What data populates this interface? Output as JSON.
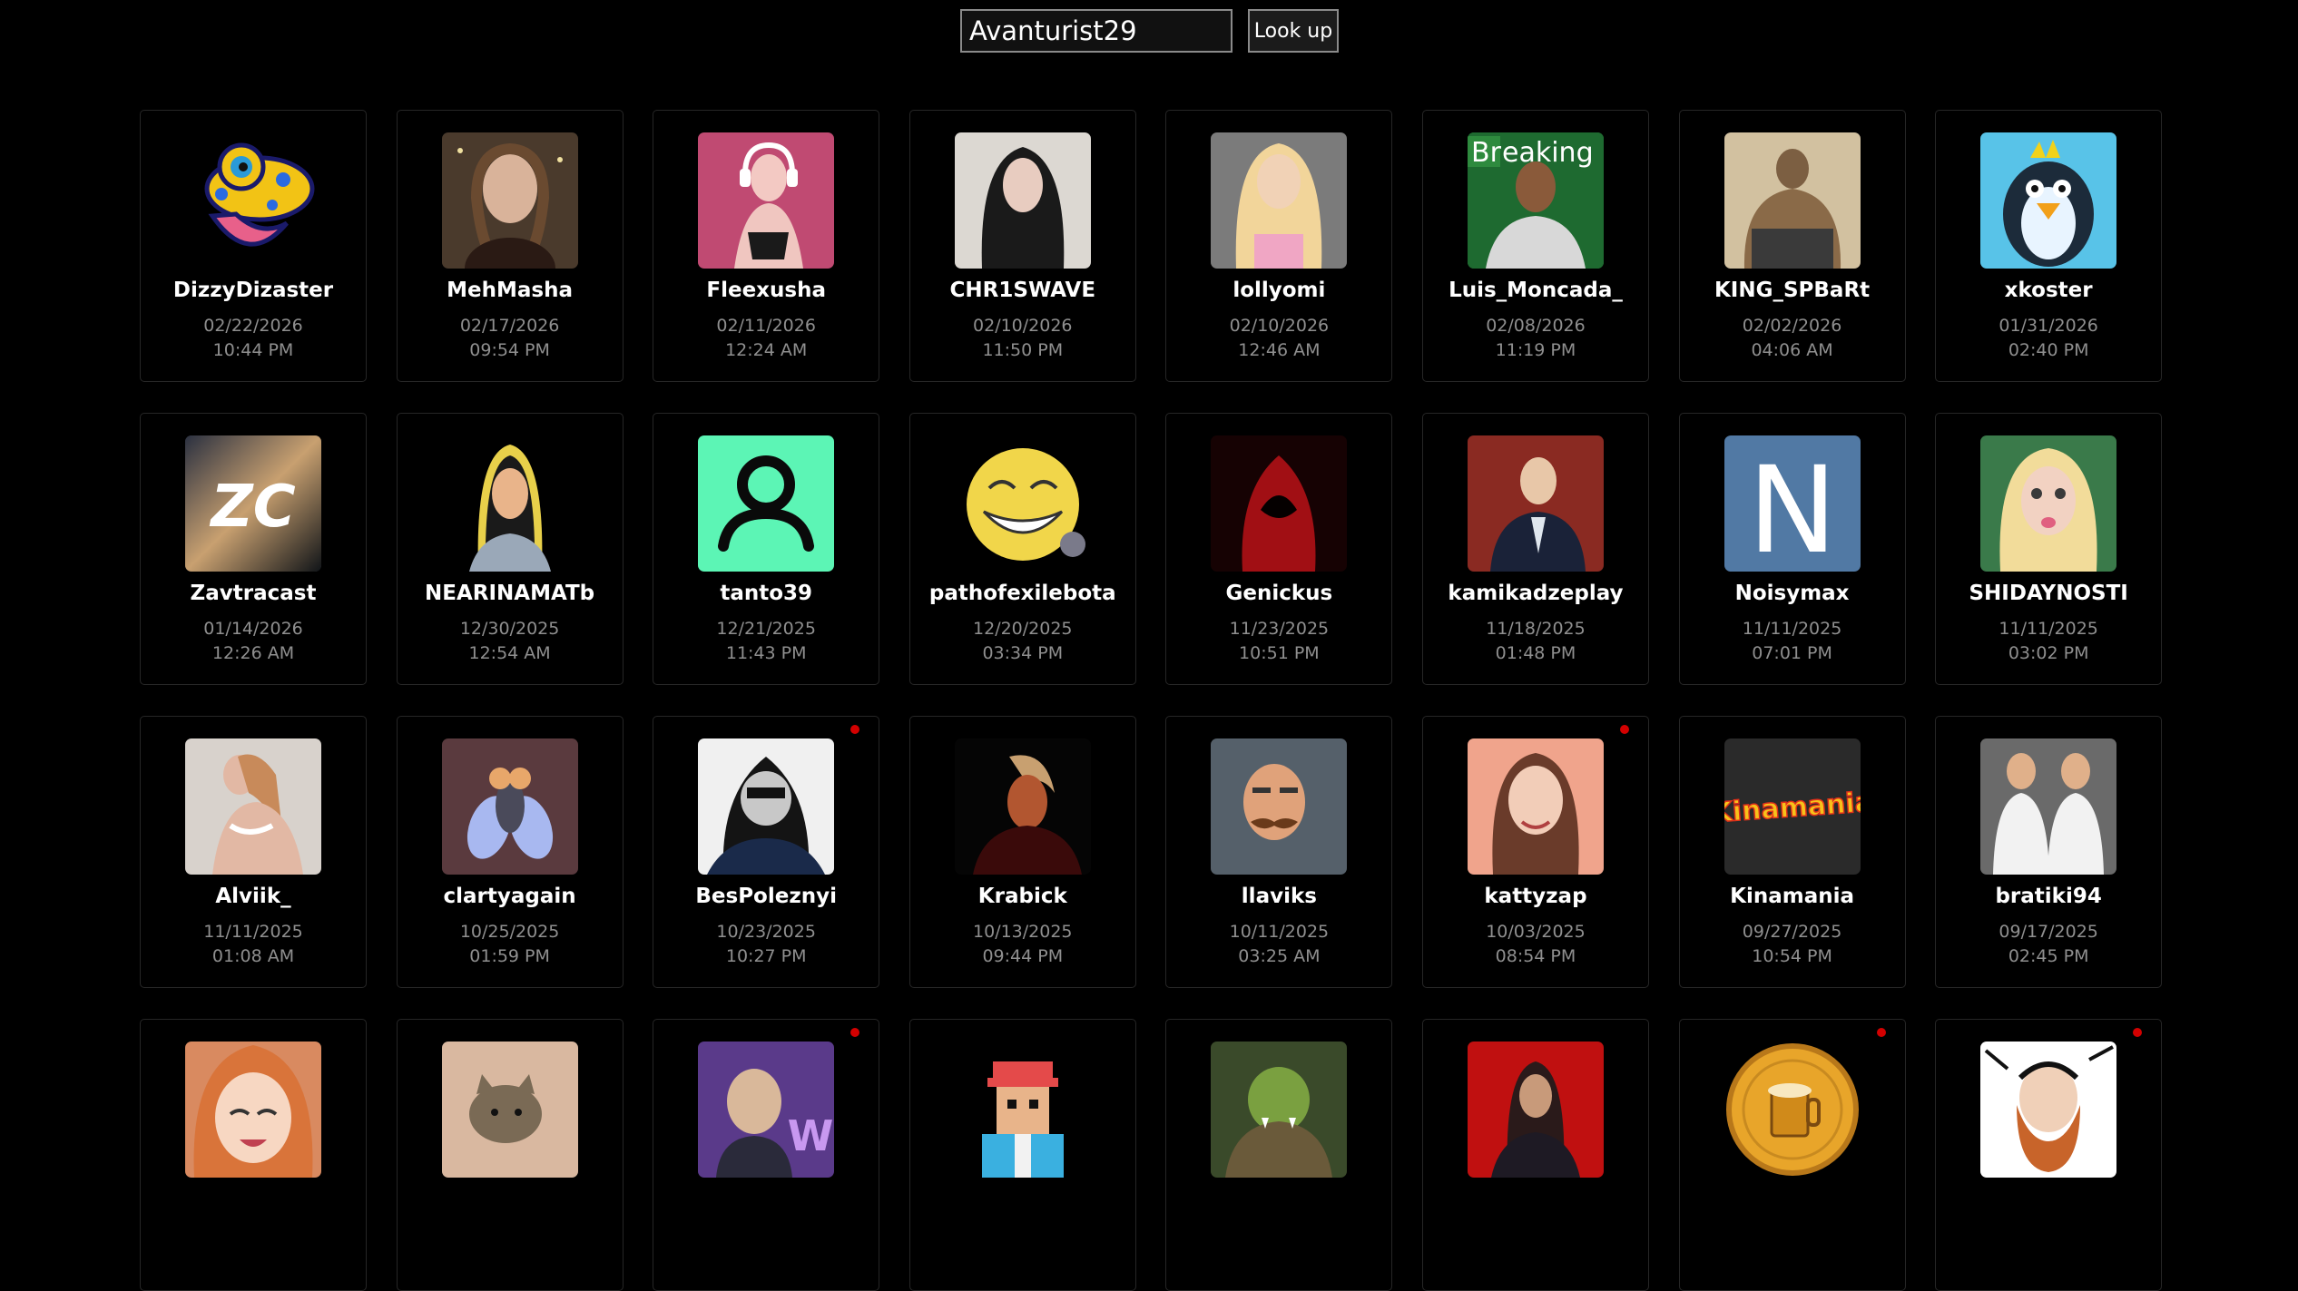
{
  "search": {
    "value": "Avanturist29",
    "button_label": "Look up"
  },
  "users": [
    {
      "name": "DizzyDizaster",
      "date": "02/22/2026",
      "time": "10:44 PM",
      "icon": "frog-mascot",
      "bg": "#000000",
      "fg": "#f2c315",
      "new": false
    },
    {
      "name": "MehMasha",
      "date": "02/17/2026",
      "time": "09:54 PM",
      "icon": "woman-portrait",
      "bg": "#4a3a2c",
      "fg": "#d9b39a",
      "new": false
    },
    {
      "name": "Fleexusha",
      "date": "02/11/2026",
      "time": "12:24 AM",
      "icon": "woman-headphones",
      "bg": "#c04a72",
      "fg": "#f3c9c3",
      "new": false
    },
    {
      "name": "CHR1SWAVE",
      "date": "02/10/2026",
      "time": "11:50 PM",
      "icon": "woman-dark-hair",
      "bg": "#dcd8d2",
      "fg": "#1a1a1a",
      "new": false
    },
    {
      "name": "lollyomi",
      "date": "02/10/2026",
      "time": "12:46 AM",
      "icon": "blonde-woman",
      "bg": "#7b7b7b",
      "fg": "#f1d2b6",
      "new": false
    },
    {
      "name": "Luis_Moncada_",
      "date": "02/08/2026",
      "time": "11:19 PM",
      "icon": "breaking-bad-portrait",
      "bg": "#2c7a3b",
      "fg": "#e0e0e0",
      "new": false
    },
    {
      "name": "KING_SPBaRt",
      "date": "02/02/2026",
      "time": "04:06 AM",
      "icon": "muscular-man",
      "bg": "#d2c1a0",
      "fg": "#7c5f42",
      "new": false
    },
    {
      "name": "xkoster",
      "date": "01/31/2026",
      "time": "02:40 PM",
      "icon": "penguin",
      "bg": "#58c3e8",
      "fg": "#1c2b3a",
      "new": false
    },
    {
      "name": "Zavtracast",
      "date": "01/14/2026",
      "time": "12:26 AM",
      "icon": "zc-logo",
      "bg": "#3a4150",
      "fg": "#ffffff",
      "new": false
    },
    {
      "name": "NEARINAMATb",
      "date": "12/30/2025",
      "time": "12:54 AM",
      "icon": "cartoon-woman",
      "bg": "#000000",
      "fg": "#e9b48a",
      "new": false
    },
    {
      "name": "tanto39",
      "date": "12/21/2025",
      "time": "11:43 PM",
      "icon": "user-silhouette",
      "bg": "#5cf5b5",
      "fg": "#0a0a0a",
      "new": false
    },
    {
      "name": "pathofexilebota",
      "date": "12/20/2025",
      "time": "03:34 PM",
      "icon": "troll-face",
      "bg": "#000000",
      "fg": "#f1d64a",
      "new": false
    },
    {
      "name": "Genickus",
      "date": "11/23/2025",
      "time": "10:51 PM",
      "icon": "red-hooded-figure",
      "bg": "#160203",
      "fg": "#a10f14",
      "new": false
    },
    {
      "name": "kamikadzeplay",
      "date": "11/18/2025",
      "time": "01:48 PM",
      "icon": "man-in-suit",
      "bg": "#8a2a22",
      "fg": "#e8c7a8",
      "new": false
    },
    {
      "name": "Noisymax",
      "date": "11/11/2025",
      "time": "07:01 PM",
      "icon": "letter-n",
      "bg": "#5179a4",
      "fg": "#ffffff",
      "new": false
    },
    {
      "name": "SHIDAYNOSTI",
      "date": "11/11/2025",
      "time": "03:02 PM",
      "icon": "blonde-doll-face",
      "bg": "#3a7a4a",
      "fg": "#f2dc9a",
      "new": false
    },
    {
      "name": "Alviik_",
      "date": "11/11/2025",
      "time": "01:08 AM",
      "icon": "woman-lingerie",
      "bg": "#d8d2cc",
      "fg": "#e2b8a4",
      "new": false
    },
    {
      "name": "clartyagain",
      "date": "10/25/2025",
      "time": "01:59 PM",
      "icon": "fly",
      "bg": "#5a3a3e",
      "fg": "#e8a76a",
      "new": false
    },
    {
      "name": "BesPoleznyi",
      "date": "10/23/2025",
      "time": "10:27 PM",
      "icon": "masked-soldier",
      "bg": "#f0f0f0",
      "fg": "#1a2a4a",
      "new": true
    },
    {
      "name": "Krabick",
      "date": "10/13/2025",
      "time": "09:44 PM",
      "icon": "dark-character",
      "bg": "#050505",
      "fg": "#b25630",
      "new": false
    },
    {
      "name": "llaviks",
      "date": "10/11/2025",
      "time": "03:25 AM",
      "icon": "mustache-man",
      "bg": "#55606a",
      "fg": "#e0a27a",
      "new": false
    },
    {
      "name": "kattyzap",
      "date": "10/03/2025",
      "time": "08:54 PM",
      "icon": "smiling-woman",
      "bg": "#f0a48c",
      "fg": "#6a3b2a",
      "new": true
    },
    {
      "name": "Kinamania",
      "date": "09/27/2025",
      "time": "10:54 PM",
      "icon": "kinamania-logo",
      "bg": "#2a2a2a",
      "fg": "#f7c21a",
      "new": false
    },
    {
      "name": "bratiki94",
      "date": "09/17/2025",
      "time": "02:45 PM",
      "icon": "two-muscle-men",
      "bg": "#6a6a6a",
      "fg": "#e0b08a",
      "new": false
    },
    {
      "name": "",
      "date": "",
      "time": "",
      "icon": "anime-girl",
      "bg": "#d98a60",
      "fg": "#f7d7c2",
      "new": false
    },
    {
      "name": "",
      "date": "",
      "time": "",
      "icon": "cat",
      "bg": "#d9b8a0",
      "fg": "#7a6a55",
      "new": false
    },
    {
      "name": "",
      "date": "",
      "time": "",
      "icon": "bald-man",
      "bg": "#5a3a8a",
      "fg": "#d9b89a",
      "new": true
    },
    {
      "name": "",
      "date": "",
      "time": "",
      "icon": "pixel-character",
      "bg": "#000000",
      "fg": "#e44a4a",
      "new": false
    },
    {
      "name": "",
      "date": "",
      "time": "",
      "icon": "orc-warrior",
      "bg": "#3a4a2a",
      "fg": "#7aa040",
      "new": false
    },
    {
      "name": "",
      "date": "",
      "time": "",
      "icon": "woman-red-background",
      "bg": "#c01010",
      "fg": "#2a1a1a",
      "new": false
    },
    {
      "name": "",
      "date": "",
      "time": "",
      "icon": "beer-coin",
      "bg": "#000000",
      "fg": "#e8a52a",
      "new": true
    },
    {
      "name": "",
      "date": "",
      "time": "",
      "icon": "bearded-man-sketch",
      "bg": "#ffffff",
      "fg": "#c8642a",
      "new": true
    }
  ]
}
